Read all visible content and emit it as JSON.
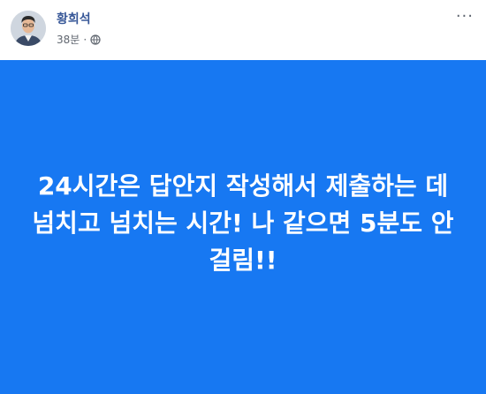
{
  "post": {
    "author": "황희석",
    "time": "38분",
    "separator": "·",
    "privacy_icon": "globe-icon",
    "more_icon": "more-options-icon",
    "more_label": "···",
    "background_color": "#1778f2",
    "text": "24시간은 답안지 작성해서 제출하는 데 넘치고 넘치는 시간! 나 같으면 5분도 안 걸림!!"
  }
}
